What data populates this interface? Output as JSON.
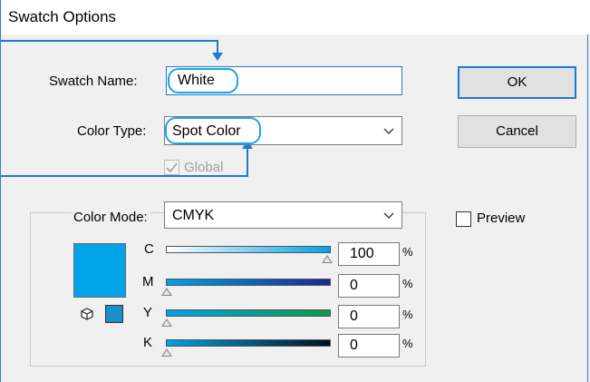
{
  "window": {
    "title": "Swatch Options"
  },
  "form": {
    "swatch_name_label": "Swatch Name:",
    "swatch_name_value": "White",
    "color_type_label": "Color Type:",
    "color_type_value": "Spot Color",
    "global_label": "Global",
    "global_checked": true,
    "color_mode_label": "Color Mode:",
    "color_mode_value": "CMYK"
  },
  "buttons": {
    "ok": "OK",
    "cancel": "Cancel"
  },
  "preview": {
    "label": "Preview",
    "checked": false
  },
  "swatch_color": "#00a2e8",
  "channels": [
    {
      "letter": "C",
      "value": "100",
      "percent_symbol": "%"
    },
    {
      "letter": "M",
      "value": "0",
      "percent_symbol": "%"
    },
    {
      "letter": "Y",
      "value": "0",
      "percent_symbol": "%"
    },
    {
      "letter": "K",
      "value": "0",
      "percent_symbol": "%"
    }
  ],
  "icons": {
    "dropdown": "chevron-down-icon",
    "out_of_gamut": "cube-icon",
    "web_safe": "web-safe-swatch-icon",
    "checkmark": "checkmark-icon"
  },
  "accent_color": "#1e78d4",
  "highlight_color": "#1aa3e8"
}
